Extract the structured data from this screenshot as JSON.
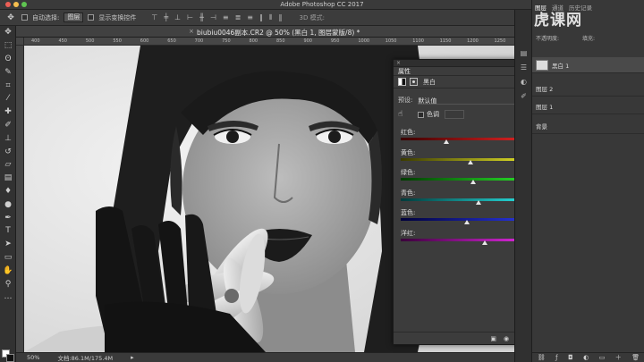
{
  "window": {
    "title": "Adobe Photoshop CC 2017"
  },
  "options_bar": {
    "auto_select_label": "自动选择:",
    "layer_select": "图层",
    "show_transform_label": "显示变换控件",
    "mode_3d": "3D 模式:"
  },
  "document": {
    "tab_title": "biubiu0046副本.CR2 @ 50% (黑白 1, 图层蒙版/8) *",
    "ruler_ticks": [
      "400",
      "450",
      "500",
      "550",
      "600",
      "650",
      "700",
      "750",
      "800",
      "850",
      "900",
      "950",
      "1000",
      "1050",
      "1100",
      "1150",
      "1200",
      "1250"
    ]
  },
  "status": {
    "zoom": "50%",
    "doc_size": "文档:86.1M/175.4M"
  },
  "properties": {
    "panel_title": "属性",
    "layer_name": "黑白",
    "preset_label": "预设:",
    "preset_value": "默认值",
    "tint_label": "色调",
    "auto_label": "自动",
    "sliders": [
      {
        "label": "红色:",
        "value": "-49",
        "num": -49,
        "color_from": "#3a0000",
        "color_to": "#ff2a2a"
      },
      {
        "label": "黄色:",
        "value": "32",
        "num": 32,
        "color_from": "#3a3a00",
        "color_to": "#ffff30"
      },
      {
        "label": "绿色:",
        "value": "40",
        "num": 40,
        "color_from": "#003a00",
        "color_to": "#30ff30"
      },
      {
        "label": "青色:",
        "value": "60",
        "num": 60,
        "color_from": "#003a3a",
        "color_to": "#30ffff"
      },
      {
        "label": "蓝色:",
        "value": "20",
        "num": 20,
        "color_from": "#00003a",
        "color_to": "#3040ff"
      },
      {
        "label": "洋红:",
        "value": "80",
        "num": 80,
        "color_from": "#3a003a",
        "color_to": "#ff30ff"
      }
    ]
  },
  "right_panel": {
    "tabs": [
      "图层",
      "通道",
      "历史记录"
    ],
    "layers": [
      {
        "label": "黑白 1"
      },
      {
        "label": "图层 2"
      },
      {
        "label": "图层 1"
      },
      {
        "label": "背景"
      }
    ],
    "opacity_label": "不透明度:",
    "fill_label": "填充:",
    "watermark": "虎课网"
  },
  "colors": {
    "accent_red": "#ff2a2a",
    "panel_bg": "#3c3c3c"
  }
}
